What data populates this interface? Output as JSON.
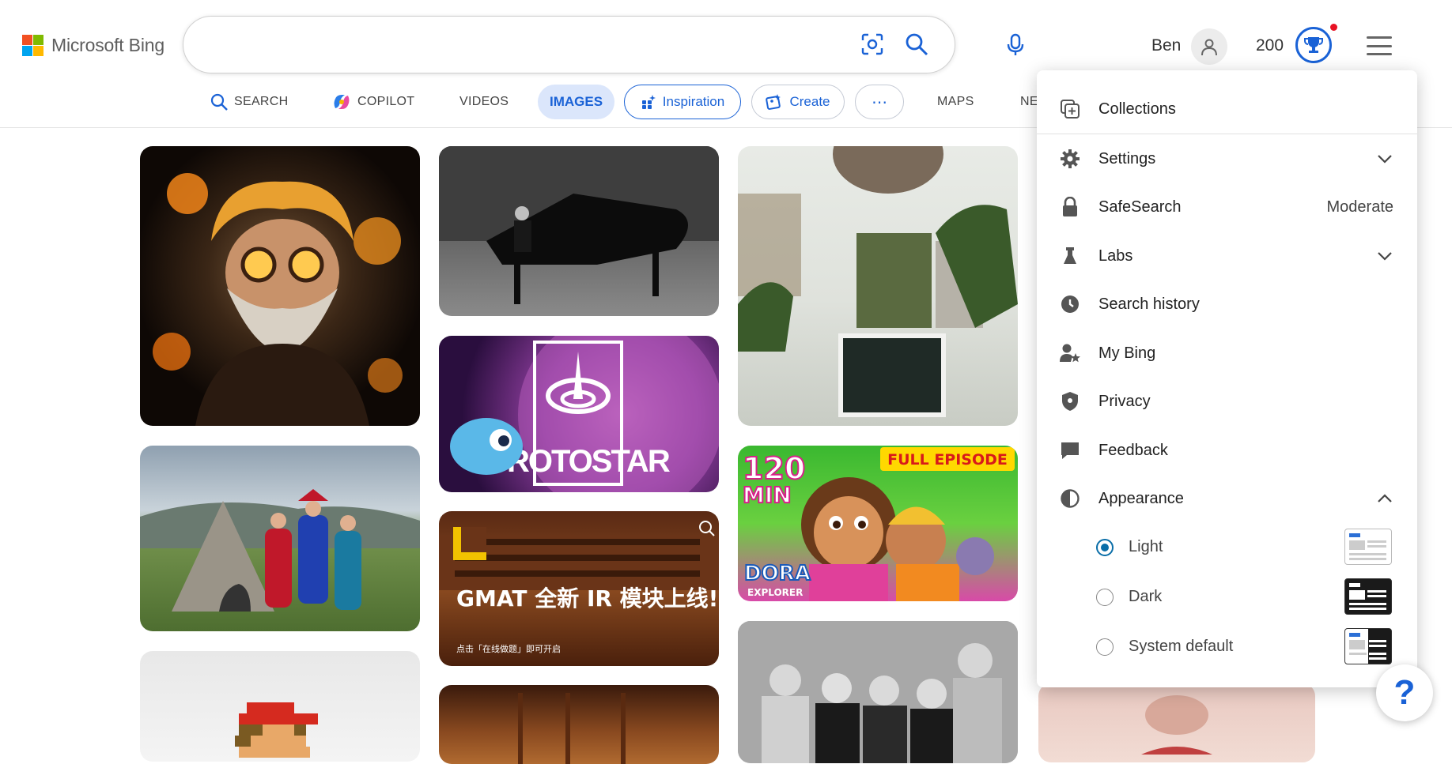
{
  "brand": {
    "name": "Microsoft Bing"
  },
  "search": {
    "placeholder": ""
  },
  "account": {
    "user_name": "Ben",
    "points": "200"
  },
  "nav": {
    "search": "SEARCH",
    "copilot": "COPILOT",
    "videos": "VIDEOS",
    "images": "IMAGES",
    "inspiration": "Inspiration",
    "create": "Create",
    "more": "⋯",
    "maps": "MAPS",
    "news_partial": "NE"
  },
  "image_text": {
    "protostar": "PROTOSTAR",
    "gmat_title": "GMAT 全新 IR 模块上线!",
    "gmat_sub": "点击「在线做题」即可开启",
    "dora_minutes": "120",
    "dora_min": "MIN",
    "dora_full": "FULL EPISODE",
    "dora_logo": "DORA",
    "dora_sub": "EXPLORER"
  },
  "menu": {
    "collections": "Collections",
    "settings": "Settings",
    "safesearch": "SafeSearch",
    "safesearch_value": "Moderate",
    "labs": "Labs",
    "search_history": "Search history",
    "my_bing": "My Bing",
    "privacy": "Privacy",
    "feedback": "Feedback",
    "appearance": "Appearance",
    "appearance_options": [
      {
        "label": "Light",
        "selected": true
      },
      {
        "label": "Dark",
        "selected": false
      },
      {
        "label": "System default",
        "selected": false
      }
    ]
  },
  "help": {
    "label": "?"
  },
  "colors": {
    "accent": "#1a62d6",
    "radio": "#0a6ea8",
    "notification": "#e81123"
  }
}
